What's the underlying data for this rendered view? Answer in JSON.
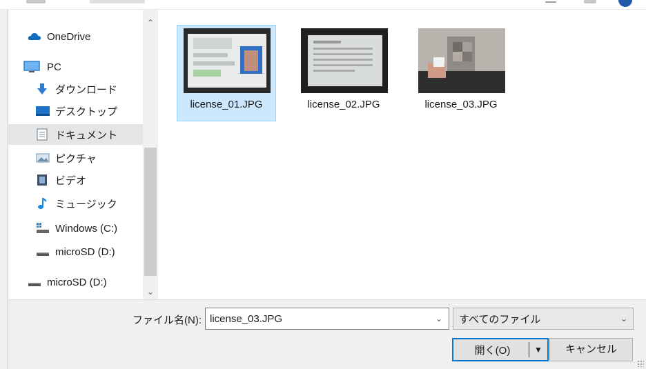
{
  "nav": {
    "items": [
      {
        "label": "OneDrive",
        "icon": "onedrive-cloud-icon",
        "color": "#0f6cbd"
      },
      {
        "label": "PC",
        "icon": "computer-icon",
        "color": "#2f7dd1"
      },
      {
        "label": "ダウンロード",
        "icon": "download-arrow-icon",
        "color": "#2f7dd1"
      },
      {
        "label": "デスクトップ",
        "icon": "desktop-icon",
        "color": "#1e73c9"
      },
      {
        "label": "ドキュメント",
        "icon": "documents-icon",
        "color": "#7a8c99"
      },
      {
        "label": "ピクチャ",
        "icon": "pictures-icon",
        "color": "#6f8faa"
      },
      {
        "label": "ビデオ",
        "icon": "videos-icon",
        "color": "#3c4e66"
      },
      {
        "label": "ミュージック",
        "icon": "music-note-icon",
        "color": "#1f8ae0"
      },
      {
        "label": "Windows (C:)",
        "icon": "windows-drive-icon",
        "color": "#555555"
      },
      {
        "label": "microSD (D:)",
        "icon": "removable-drive-icon",
        "color": "#555555"
      },
      {
        "label": "microSD (D:)",
        "icon": "removable-drive-icon",
        "color": "#555555"
      }
    ],
    "selected_index": 4
  },
  "files": [
    {
      "name": "license_01.JPG",
      "selected": true
    },
    {
      "name": "license_02.JPG",
      "selected": false
    },
    {
      "name": "license_03.JPG",
      "selected": false
    }
  ],
  "filename": {
    "label": "ファイル名(N):",
    "value": "license_03.JPG"
  },
  "filetype": {
    "value": "すべてのファイル"
  },
  "buttons": {
    "open": "開く(O)",
    "cancel": "キャンセル"
  },
  "colors": {
    "selection_bg": "#cce8ff",
    "selection_border": "#99d1ff",
    "accent": "#0078d7",
    "footer_bg": "#f0f0f0"
  }
}
